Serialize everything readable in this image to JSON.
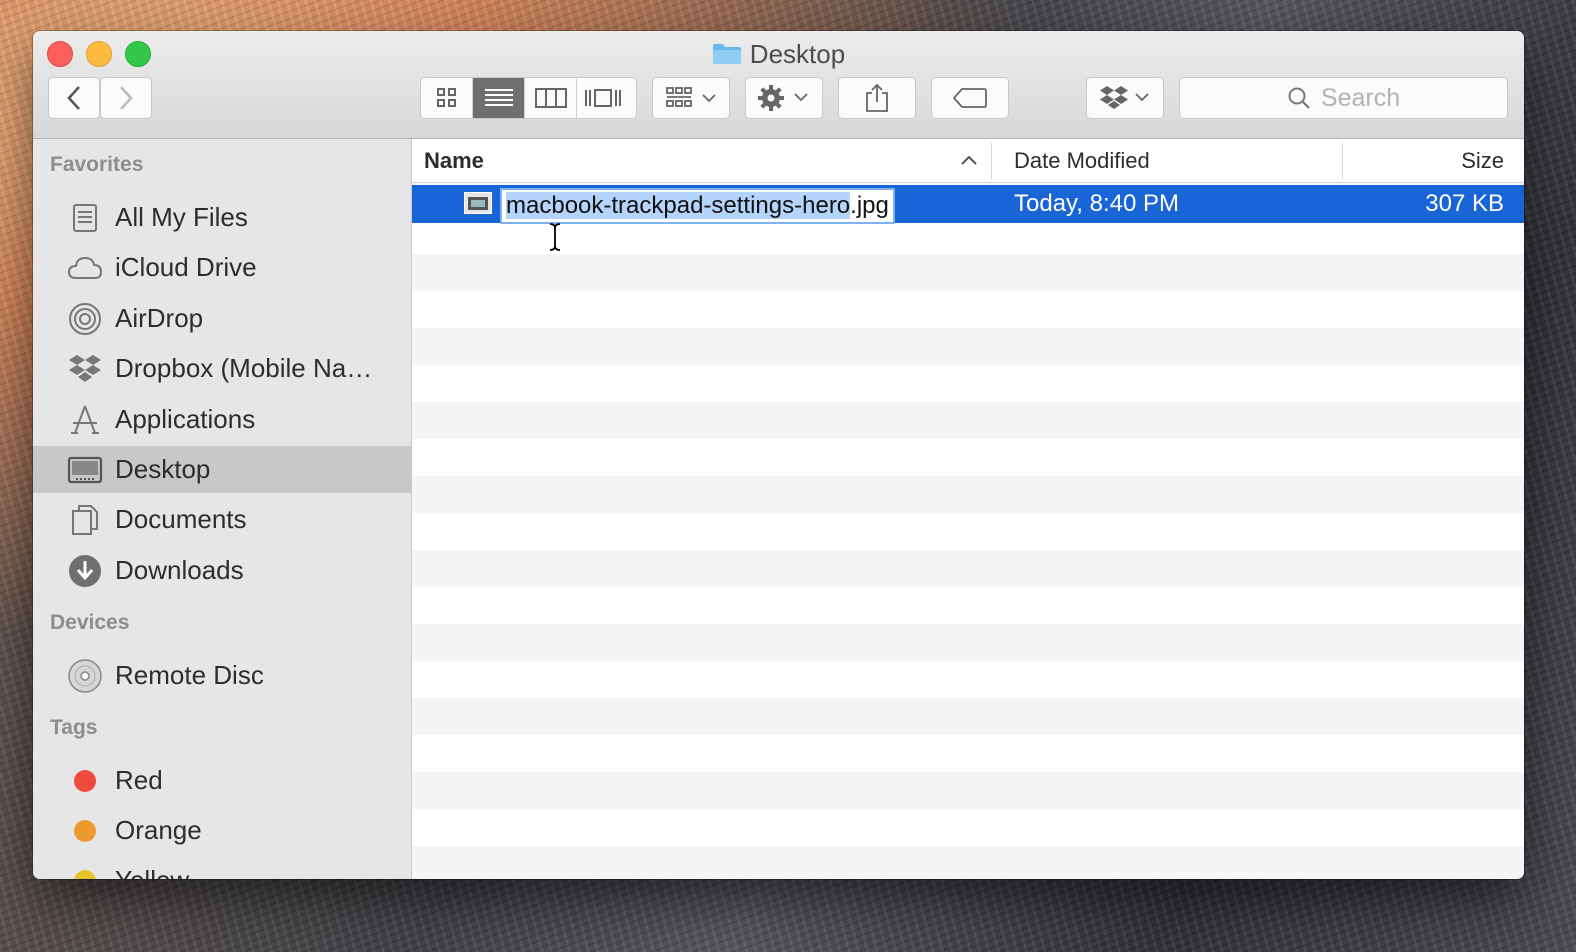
{
  "window": {
    "title": "Desktop"
  },
  "toolbar": {
    "search_placeholder": "Search",
    "icons": [
      "back-icon",
      "forward-icon",
      "icon-view-icon",
      "list-view-icon",
      "column-view-icon",
      "cover-flow-icon",
      "arrange-icon",
      "gear-icon",
      "share-icon",
      "tag-icon",
      "dropbox-icon",
      "search-icon"
    ]
  },
  "sidebar": {
    "favorites_header": "Favorites",
    "favorites": [
      {
        "label": "All My Files",
        "icon": "all-files-icon"
      },
      {
        "label": "iCloud Drive",
        "icon": "cloud-icon"
      },
      {
        "label": "AirDrop",
        "icon": "airdrop-icon"
      },
      {
        "label": "Dropbox (Mobile Na…",
        "icon": "dropbox-icon"
      },
      {
        "label": "Applications",
        "icon": "applications-icon"
      },
      {
        "label": "Desktop",
        "icon": "desktop-icon",
        "selected": true
      },
      {
        "label": "Documents",
        "icon": "documents-icon"
      },
      {
        "label": "Downloads",
        "icon": "downloads-icon"
      }
    ],
    "devices_header": "Devices",
    "devices": [
      {
        "label": "Remote Disc",
        "icon": "disc-icon"
      }
    ],
    "tags_header": "Tags",
    "tags": [
      {
        "label": "Red",
        "color": "#ee4b3e"
      },
      {
        "label": "Orange",
        "color": "#ef9a2f"
      },
      {
        "label": "Yellow",
        "color": "#e8c22c"
      }
    ]
  },
  "list": {
    "columns": {
      "name": "Name",
      "date": "Date Modified",
      "size": "Size"
    },
    "sort_indicator": "^",
    "rows": [
      {
        "name_selected_part": "macbook-trackpad-settings-hero",
        "name_extension": ".jpg",
        "date": "Today, 8:40 PM",
        "size": "307 KB"
      }
    ]
  },
  "colors": {
    "selection": "#1965d8",
    "sidebar_bg": "#e6e6e6"
  }
}
